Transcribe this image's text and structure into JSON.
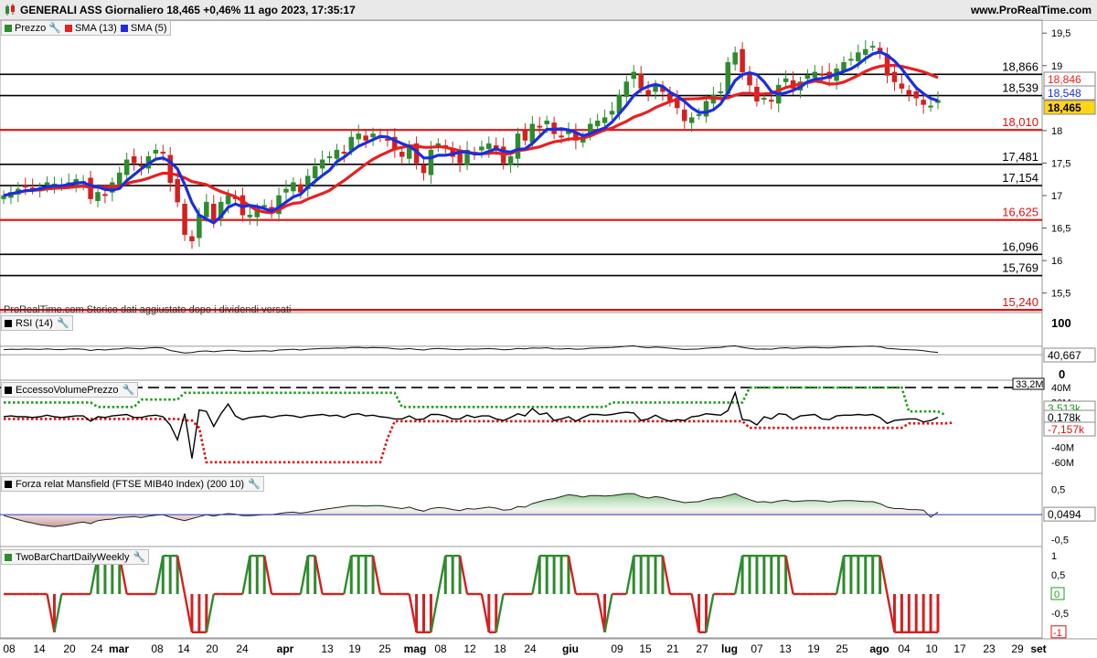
{
  "header": {
    "title": "GENERALI ASS Giornaliero 18,465 +0,46% 11 ago 2023, 17:35:17",
    "site": "www.ProRealTime.com"
  },
  "colors": {
    "up": "#2e8b2e",
    "down": "#d42020",
    "sma13": "#e82020",
    "sma5": "#1a2ee0",
    "level_black": "#000000",
    "level_red": "#e01010"
  },
  "price_panel": {
    "legend": [
      {
        "label": "Prezzo",
        "color": "#2e8b2e",
        "icon": "wrench-icon"
      },
      {
        "label": "SMA (13)",
        "color": "#e82020"
      },
      {
        "label": "SMA (5)",
        "color": "#1a2ee0"
      }
    ],
    "watermark": "ProRealTime.com  Storico dati aggiustato dopo i dividendi versati",
    "axis_ticks": [
      "19,5",
      "19",
      "18,5",
      "18",
      "17,5",
      "17",
      "16,5",
      "16",
      "15,5"
    ],
    "levels": [
      {
        "label": "18,866",
        "value": 18.866,
        "color": "black"
      },
      {
        "label": "18,539",
        "value": 18.539,
        "color": "black"
      },
      {
        "label": "18,010",
        "value": 18.01,
        "color": "red"
      },
      {
        "label": "17,481",
        "value": 17.481,
        "color": "black"
      },
      {
        "label": "17,154",
        "value": 17.154,
        "color": "black"
      },
      {
        "label": "16,625",
        "value": 16.625,
        "color": "red"
      },
      {
        "label": "16,096",
        "value": 16.096,
        "color": "black"
      },
      {
        "label": "15,769",
        "value": 15.769,
        "color": "black"
      },
      {
        "label": "15,240",
        "value": 15.24,
        "color": "red"
      }
    ],
    "badges": {
      "sma13": "18,846",
      "sma5": "18,548",
      "price": "18,465"
    }
  },
  "rsi_panel": {
    "legend": "RSI (14)",
    "axis_ticks": [
      "100",
      "0"
    ],
    "badge": "40,667"
  },
  "volume_panel": {
    "legend": "EccessoVolumePrezzo",
    "axis_ticks": [
      "40M",
      "20M",
      "-20M",
      "-40M",
      "-60M"
    ],
    "top_label": "33,2M",
    "badges": {
      "green": "3,513k",
      "black": "0,178k",
      "red": "-7,157k"
    }
  },
  "mansfield_panel": {
    "legend": "Forza relat Mansfield (FTSE MIB40 Index) (200 10)",
    "axis_ticks": [
      "0,5",
      "-0,5"
    ],
    "badge": "0,0494"
  },
  "twobar_panel": {
    "legend": "TwoBarChartDailyWeekly",
    "axis_ticks": [
      "1",
      "0,5",
      "-0,5"
    ],
    "badges": [
      "0",
      "-1"
    ]
  },
  "x_axis": [
    "08",
    "14",
    "20",
    "24",
    "mar",
    "08",
    "14",
    "20",
    "24",
    "apr",
    "13",
    "19",
    "25",
    "mag",
    "08",
    "12",
    "18",
    "24",
    "giu",
    "09",
    "15",
    "21",
    "27",
    "lug",
    "07",
    "13",
    "19",
    "25",
    "ago",
    "04",
    "10",
    "17",
    "23",
    "29",
    "set"
  ],
  "chart_data": [
    {
      "type": "candlestick",
      "title": "GENERALI ASS Giornaliero",
      "y_ticks": [
        15.5,
        16,
        16.5,
        17,
        17.5,
        18,
        18.5,
        19,
        19.5
      ],
      "ylim": [
        15.2,
        19.7
      ],
      "x": [
        "2023-02-08",
        "2023-02-09",
        "2023-02-10",
        "2023-02-13",
        "2023-02-14",
        "2023-02-15",
        "2023-02-16",
        "2023-02-17",
        "2023-02-20",
        "2023-02-21",
        "2023-02-22",
        "2023-02-23",
        "2023-02-24",
        "2023-02-27",
        "2023-02-28",
        "2023-03-01",
        "2023-03-02",
        "2023-03-03",
        "2023-03-06",
        "2023-03-07",
        "2023-03-08",
        "2023-03-09",
        "2023-03-10",
        "2023-03-13",
        "2023-03-14",
        "2023-03-15",
        "2023-03-16",
        "2023-03-17",
        "2023-03-20",
        "2023-03-21",
        "2023-03-22",
        "2023-03-23",
        "2023-03-24",
        "2023-03-27",
        "2023-03-28",
        "2023-03-29",
        "2023-03-30",
        "2023-03-31",
        "2023-04-03",
        "2023-04-04",
        "2023-04-05",
        "2023-04-06",
        "2023-04-11",
        "2023-04-12",
        "2023-04-13",
        "2023-04-14",
        "2023-04-17",
        "2023-04-18",
        "2023-04-19",
        "2023-04-20",
        "2023-04-21",
        "2023-04-24",
        "2023-04-25",
        "2023-04-26",
        "2023-04-27",
        "2023-04-28",
        "2023-05-02",
        "2023-05-03",
        "2023-05-04",
        "2023-05-05",
        "2023-05-08",
        "2023-05-09",
        "2023-05-10",
        "2023-05-11",
        "2023-05-12",
        "2023-05-15",
        "2023-05-16",
        "2023-05-17",
        "2023-05-18",
        "2023-05-19",
        "2023-05-22",
        "2023-05-23",
        "2023-05-24",
        "2023-05-25",
        "2023-05-26",
        "2023-05-29",
        "2023-05-30",
        "2023-05-31",
        "2023-06-01",
        "2023-06-02",
        "2023-06-05",
        "2023-06-06",
        "2023-06-07",
        "2023-06-08",
        "2023-06-09",
        "2023-06-12",
        "2023-06-13",
        "2023-06-14",
        "2023-06-15",
        "2023-06-16",
        "2023-06-19",
        "2023-06-20",
        "2023-06-21",
        "2023-06-22",
        "2023-06-23",
        "2023-06-26",
        "2023-06-27",
        "2023-06-28",
        "2023-06-29",
        "2023-06-30",
        "2023-07-03",
        "2023-07-04",
        "2023-07-05",
        "2023-07-06",
        "2023-07-07",
        "2023-07-10",
        "2023-07-11",
        "2023-07-12",
        "2023-07-13",
        "2023-07-14",
        "2023-07-17",
        "2023-07-18",
        "2023-07-19",
        "2023-07-20",
        "2023-07-21",
        "2023-07-24",
        "2023-07-25",
        "2023-07-26",
        "2023-07-27",
        "2023-07-28",
        "2023-07-31",
        "2023-08-01",
        "2023-08-02",
        "2023-08-03",
        "2023-08-04",
        "2023-08-07",
        "2023-08-08",
        "2023-08-09",
        "2023-08-10",
        "2023-08-11"
      ],
      "close": [
        17.0,
        17.05,
        17.1,
        17.15,
        17.1,
        17.12,
        17.2,
        17.18,
        17.15,
        17.2,
        17.25,
        17.22,
        16.95,
        17.05,
        17.0,
        17.2,
        17.35,
        17.55,
        17.5,
        17.45,
        17.6,
        17.7,
        17.65,
        17.2,
        16.9,
        16.4,
        16.3,
        16.7,
        16.9,
        16.6,
        16.9,
        17.0,
        16.95,
        16.7,
        16.7,
        16.8,
        16.85,
        16.75,
        17.0,
        17.1,
        17.2,
        17.05,
        17.3,
        17.45,
        17.55,
        17.6,
        17.7,
        17.65,
        17.9,
        17.95,
        17.85,
        17.95,
        17.9,
        17.85,
        17.7,
        17.6,
        17.75,
        17.5,
        17.35,
        17.7,
        17.8,
        17.75,
        17.6,
        17.5,
        17.7,
        17.65,
        17.75,
        17.8,
        17.7,
        17.5,
        17.6,
        17.95,
        17.85,
        18.1,
        18.05,
        18.15,
        17.95,
        17.9,
        18.0,
        17.85,
        17.9,
        18.1,
        18.15,
        18.2,
        18.3,
        18.55,
        18.75,
        18.9,
        18.65,
        18.55,
        18.7,
        18.6,
        18.45,
        18.35,
        18.15,
        18.2,
        18.25,
        18.45,
        18.55,
        18.6,
        19.05,
        19.2,
        18.9,
        18.7,
        18.45,
        18.5,
        18.45,
        18.7,
        18.8,
        18.65,
        18.75,
        18.85,
        18.9,
        18.85,
        18.8,
        18.95,
        19.05,
        19.1,
        19.2,
        19.25,
        19.3,
        19.2,
        18.85,
        18.75,
        18.65,
        18.55,
        18.5,
        18.4,
        18.38,
        18.465
      ]
    },
    {
      "type": "line",
      "title": "RSI (14)",
      "ylim": [
        0,
        100
      ],
      "values": [
        54,
        56,
        55,
        57,
        56,
        55,
        58,
        55,
        54,
        57,
        58,
        56,
        50,
        55,
        52,
        56,
        58,
        62,
        60,
        58,
        62,
        64,
        62,
        50,
        44,
        38,
        40,
        46,
        48,
        44,
        48,
        51,
        50,
        46,
        46,
        48,
        49,
        47,
        52,
        54,
        56,
        52,
        56,
        58,
        60,
        60,
        62,
        61,
        64,
        65,
        62,
        64,
        63,
        62,
        58,
        56,
        59,
        55,
        52,
        58,
        60,
        58,
        55,
        53,
        57,
        56,
        58,
        59,
        57,
        53,
        55,
        60,
        58,
        62,
        61,
        63,
        58,
        57,
        59,
        56,
        57,
        61,
        62,
        63,
        64,
        67,
        70,
        72,
        66,
        63,
        66,
        64,
        61,
        58,
        55,
        56,
        57,
        61,
        63,
        64,
        70,
        72,
        65,
        60,
        56,
        57,
        56,
        61,
        63,
        60,
        62,
        64,
        65,
        63,
        62,
        65,
        67,
        68,
        69,
        70,
        71,
        68,
        60,
        58,
        55,
        53,
        52,
        49,
        44,
        40.667
      ]
    },
    {
      "type": "line",
      "title": "EccessoVolumePrezzo",
      "ylim": [
        -70,
        45
      ],
      "series": [
        {
          "values": [
            1,
            2,
            1,
            1,
            0,
            1,
            3,
            1,
            0,
            1,
            2,
            2,
            -5,
            1,
            0,
            2,
            3,
            4,
            0,
            0,
            2,
            3,
            1,
            -10,
            -30,
            5,
            -55,
            10,
            8,
            -12,
            5,
            18,
            2,
            -3,
            0,
            1,
            2,
            0,
            2,
            3,
            2,
            0,
            2,
            3,
            4,
            2,
            3,
            0,
            4,
            5,
            2,
            3,
            1,
            0,
            -2,
            -2,
            2,
            -3,
            -2,
            4,
            4,
            2,
            -2,
            -2,
            3,
            0,
            2,
            2,
            -2,
            -4,
            0,
            5,
            2,
            12,
            4,
            6,
            -4,
            -2,
            1,
            -5,
            0,
            4,
            4,
            3,
            4,
            6,
            7,
            6,
            -4,
            -2,
            3,
            -2,
            -5,
            -3,
            -4,
            1,
            2,
            5,
            4,
            3,
            9,
            33.2,
            -3,
            -4,
            -10,
            1,
            -2,
            5,
            4,
            -3,
            2,
            3,
            4,
            -2,
            -3,
            2,
            3,
            3,
            4,
            3,
            4,
            0,
            -8,
            -4,
            -3,
            -2,
            -2,
            -6,
            -4,
            0.178
          ]
        },
        {
          "values": [
            20,
            20,
            20,
            20,
            20,
            20,
            20,
            20,
            20,
            20,
            20,
            20,
            20,
            14,
            14,
            14,
            14,
            14,
            14,
            24,
            24,
            24,
            24,
            24,
            24,
            33,
            33,
            33,
            33,
            33,
            33,
            33,
            33,
            33,
            33,
            33,
            33,
            33,
            33,
            33,
            33,
            33,
            33,
            33,
            33,
            33,
            33,
            33,
            33,
            33,
            33,
            33,
            33,
            33,
            33,
            14,
            14,
            14,
            14,
            14,
            14,
            14,
            14,
            14,
            14,
            14,
            14,
            14,
            14,
            14,
            14,
            14,
            14,
            14,
            14,
            14,
            14,
            14,
            14,
            14,
            14,
            14,
            14,
            14,
            20,
            20,
            20,
            20,
            20,
            20,
            20,
            20,
            20,
            20,
            20,
            20,
            20,
            20,
            20,
            20,
            20,
            20,
            20,
            40,
            40,
            40,
            40,
            40,
            40,
            40,
            40,
            40,
            40,
            40,
            40,
            40,
            40,
            40,
            40,
            40,
            40,
            40,
            40,
            40,
            40,
            8,
            8,
            8,
            8,
            8,
            3.513
          ]
        },
        {
          "values": [
            -2,
            -2,
            -2,
            -2,
            -2,
            -2,
            -2,
            -2,
            -2,
            -2,
            -2,
            -2,
            -2,
            -2,
            -2,
            -2,
            -2,
            -2,
            -2,
            -2,
            -2,
            -2,
            -2,
            -2,
            -2,
            -4,
            -4,
            -14,
            -60,
            -60,
            -60,
            -60,
            -60,
            -60,
            -60,
            -60,
            -60,
            -60,
            -60,
            -60,
            -60,
            -60,
            -60,
            -60,
            -60,
            -60,
            -60,
            -60,
            -60,
            -60,
            -60,
            -60,
            -60,
            -28,
            -5,
            -5,
            -5,
            -5,
            -5,
            -5,
            -5,
            -5,
            -5,
            -5,
            -5,
            -5,
            -5,
            -5,
            -5,
            -5,
            -5,
            -5,
            -5,
            -5,
            -5,
            -5,
            -5,
            -5,
            -5,
            -5,
            -5,
            -5,
            -5,
            -5,
            -5,
            -5,
            -5,
            -5,
            -5,
            -5,
            -5,
            -5,
            -5,
            -5,
            -5,
            -5,
            -5,
            -5,
            -5,
            -5,
            -5,
            -5,
            -5,
            -14,
            -14,
            -14,
            -14,
            -14,
            -14,
            -14,
            -14,
            -14,
            -14,
            -14,
            -14,
            -14,
            -14,
            -14,
            -14,
            -14,
            -14,
            -14,
            -14,
            -14,
            -14,
            -8,
            -8,
            -8,
            -8,
            -8,
            -8,
            -7.157
          ]
        }
      ]
    },
    {
      "type": "area",
      "title": "Forza relat Mansfield (FTSE MIB40 Index) (200 10)",
      "ylim": [
        -0.6,
        0.75
      ],
      "values": [
        -0.02,
        -0.06,
        -0.1,
        -0.14,
        -0.17,
        -0.2,
        -0.22,
        -0.24,
        -0.22,
        -0.2,
        -0.17,
        -0.15,
        -0.18,
        -0.12,
        -0.1,
        -0.09,
        -0.06,
        -0.05,
        -0.04,
        -0.06,
        -0.03,
        -0.01,
        0.0,
        -0.05,
        -0.09,
        -0.12,
        -0.08,
        -0.04,
        0.0,
        -0.03,
        0.0,
        0.02,
        0.01,
        -0.02,
        -0.02,
        -0.01,
        0.0,
        0.0,
        0.02,
        0.04,
        0.05,
        0.03,
        0.05,
        0.08,
        0.1,
        0.12,
        0.14,
        0.16,
        0.18,
        0.18,
        0.17,
        0.18,
        0.18,
        0.16,
        0.14,
        0.12,
        0.15,
        0.1,
        0.07,
        0.12,
        0.14,
        0.13,
        0.1,
        0.08,
        0.12,
        0.11,
        0.13,
        0.15,
        0.13,
        0.09,
        0.1,
        0.16,
        0.15,
        0.22,
        0.26,
        0.3,
        0.32,
        0.36,
        0.4,
        0.38,
        0.35,
        0.38,
        0.38,
        0.37,
        0.38,
        0.4,
        0.42,
        0.42,
        0.36,
        0.33,
        0.36,
        0.34,
        0.3,
        0.27,
        0.24,
        0.25,
        0.26,
        0.3,
        0.33,
        0.34,
        0.38,
        0.42,
        0.35,
        0.3,
        0.25,
        0.26,
        0.24,
        0.27,
        0.29,
        0.26,
        0.27,
        0.28,
        0.28,
        0.27,
        0.25,
        0.27,
        0.28,
        0.28,
        0.27,
        0.26,
        0.26,
        0.22,
        0.15,
        0.12,
        0.12,
        0.1,
        0.1,
        0.09,
        -0.05,
        0.0494
      ]
    },
    {
      "type": "line",
      "title": "TwoBarChartDailyWeekly",
      "ylim": [
        -1.1,
        1.1
      ],
      "values": [
        0,
        0,
        0,
        0,
        0,
        0,
        0,
        -1,
        0,
        0,
        0,
        0,
        0,
        1,
        1,
        1,
        1,
        0,
        0,
        0,
        0,
        0,
        1,
        1,
        1,
        0,
        -1,
        -1,
        -1,
        0,
        0,
        0,
        0,
        0,
        1,
        1,
        1,
        0,
        0,
        0,
        0,
        0,
        1,
        1,
        0,
        0,
        0,
        0,
        1,
        1,
        1,
        1,
        0,
        0,
        0,
        0,
        0,
        -1,
        -1,
        -1,
        0,
        1,
        1,
        1,
        0,
        0,
        0,
        -1,
        -1,
        0,
        0,
        0,
        0,
        0,
        1,
        1,
        1,
        1,
        1,
        0,
        0,
        0,
        0,
        -1,
        0,
        0,
        0,
        1,
        1,
        1,
        1,
        1,
        0,
        0,
        0,
        0,
        -1,
        -1,
        0,
        0,
        0,
        0,
        1,
        1,
        1,
        1,
        1,
        1,
        1,
        0,
        0,
        0,
        0,
        0,
        0,
        0,
        1,
        1,
        1,
        1,
        1,
        1,
        0,
        -1,
        -1,
        -1,
        -1,
        -1,
        -1,
        -1
      ]
    }
  ]
}
